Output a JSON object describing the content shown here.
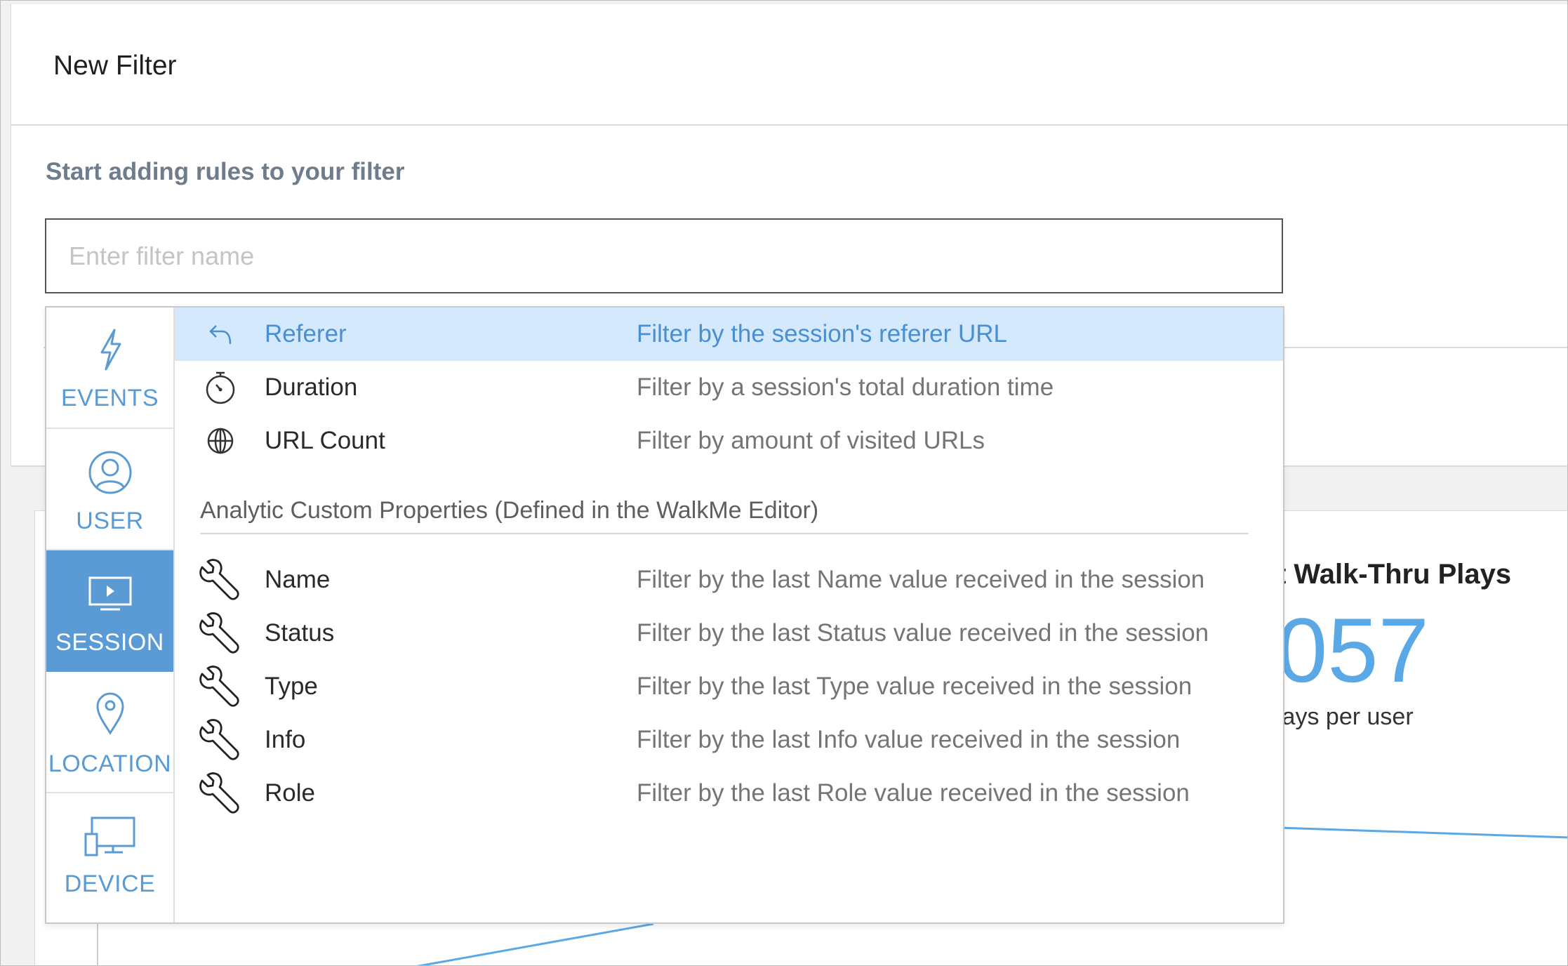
{
  "header": {
    "title": "New Filter"
  },
  "panel": {
    "heading": "Start adding rules to your filter",
    "input_placeholder": "Enter filter name",
    "input_value": ""
  },
  "categories": [
    {
      "label": "EVENTS",
      "icon": "lightning-icon",
      "active": false
    },
    {
      "label": "USER",
      "icon": "user-icon",
      "active": false
    },
    {
      "label": "SESSION",
      "icon": "monitor-play-icon",
      "active": true
    },
    {
      "label": "LOCATION",
      "icon": "map-pin-icon",
      "active": false
    },
    {
      "label": "DEVICE",
      "icon": "devices-icon",
      "active": false
    }
  ],
  "options": [
    {
      "name": "Referer",
      "desc": "Filter by the session's referer URL",
      "icon": "back-arrow-icon",
      "highlighted": true
    },
    {
      "name": "Duration",
      "desc": "Filter by a session's total duration time",
      "icon": "stopwatch-icon"
    },
    {
      "name": "URL Count",
      "desc": "Filter by amount of visited URLs",
      "icon": "globe-icon"
    }
  ],
  "custom_section": {
    "label": "Analytic Custom Properties (Defined in the WalkMe Editor)",
    "items": [
      {
        "name": "Name",
        "desc": "Filter by the last Name value received in the session",
        "icon": "wrench-icon"
      },
      {
        "name": "Status",
        "desc": "Filter by the last Status value received in the session",
        "icon": "wrench-icon"
      },
      {
        "name": "Type",
        "desc": "Filter by the last Type value received in the session",
        "icon": "wrench-icon"
      },
      {
        "name": "Info",
        "desc": "Filter by the last Info value received in the session",
        "icon": "wrench-icon"
      },
      {
        "name": "Role",
        "desc": "Filter by the last Role value received in the session",
        "icon": "wrench-icon"
      }
    ]
  },
  "background_card": {
    "title": "t Walk-Thru Plays",
    "value": "057",
    "subtitle": "lays per user"
  },
  "colors": {
    "accent": "#5b9bd5",
    "highlight": "#d4e9fb",
    "value_blue": "#5aa9e6"
  }
}
